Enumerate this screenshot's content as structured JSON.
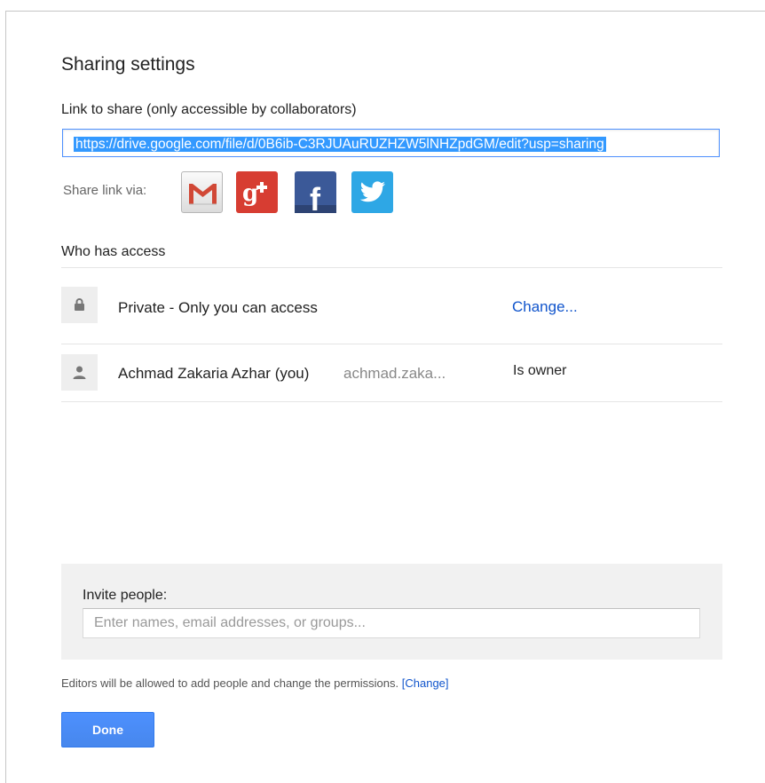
{
  "dialog": {
    "title": "Sharing settings",
    "link_label": "Link to share (only accessible by collaborators)",
    "link_url": "https://drive.google.com/file/d/0B6ib-C3RJUAuRUZHZW5lNHZpdGM/edit?usp=sharing",
    "share_via_label": "Share link via:",
    "share_icons": [
      "gmail-icon",
      "google-plus-icon",
      "facebook-icon",
      "twitter-icon"
    ],
    "who_has_access": "Who has access",
    "access_rows": [
      {
        "icon": "lock-icon",
        "label": "Private - Only you can access",
        "action": "Change..."
      },
      {
        "icon": "person-icon",
        "label": "Achmad Zakaria Azhar (you)",
        "email": "achmad.zaka...",
        "role": "Is owner"
      }
    ],
    "invite_label": "Invite people:",
    "invite_placeholder": "Enter names, email addresses, or groups...",
    "editors_note": "Editors will be allowed to add people and change the permissions.",
    "editors_change": "[Change]",
    "done_label": "Done"
  },
  "colors": {
    "accent": "#4d90fe",
    "link": "#1155cc",
    "gplus": "#d73d32",
    "facebook": "#3b5998",
    "twitter": "#2ea7e5"
  }
}
